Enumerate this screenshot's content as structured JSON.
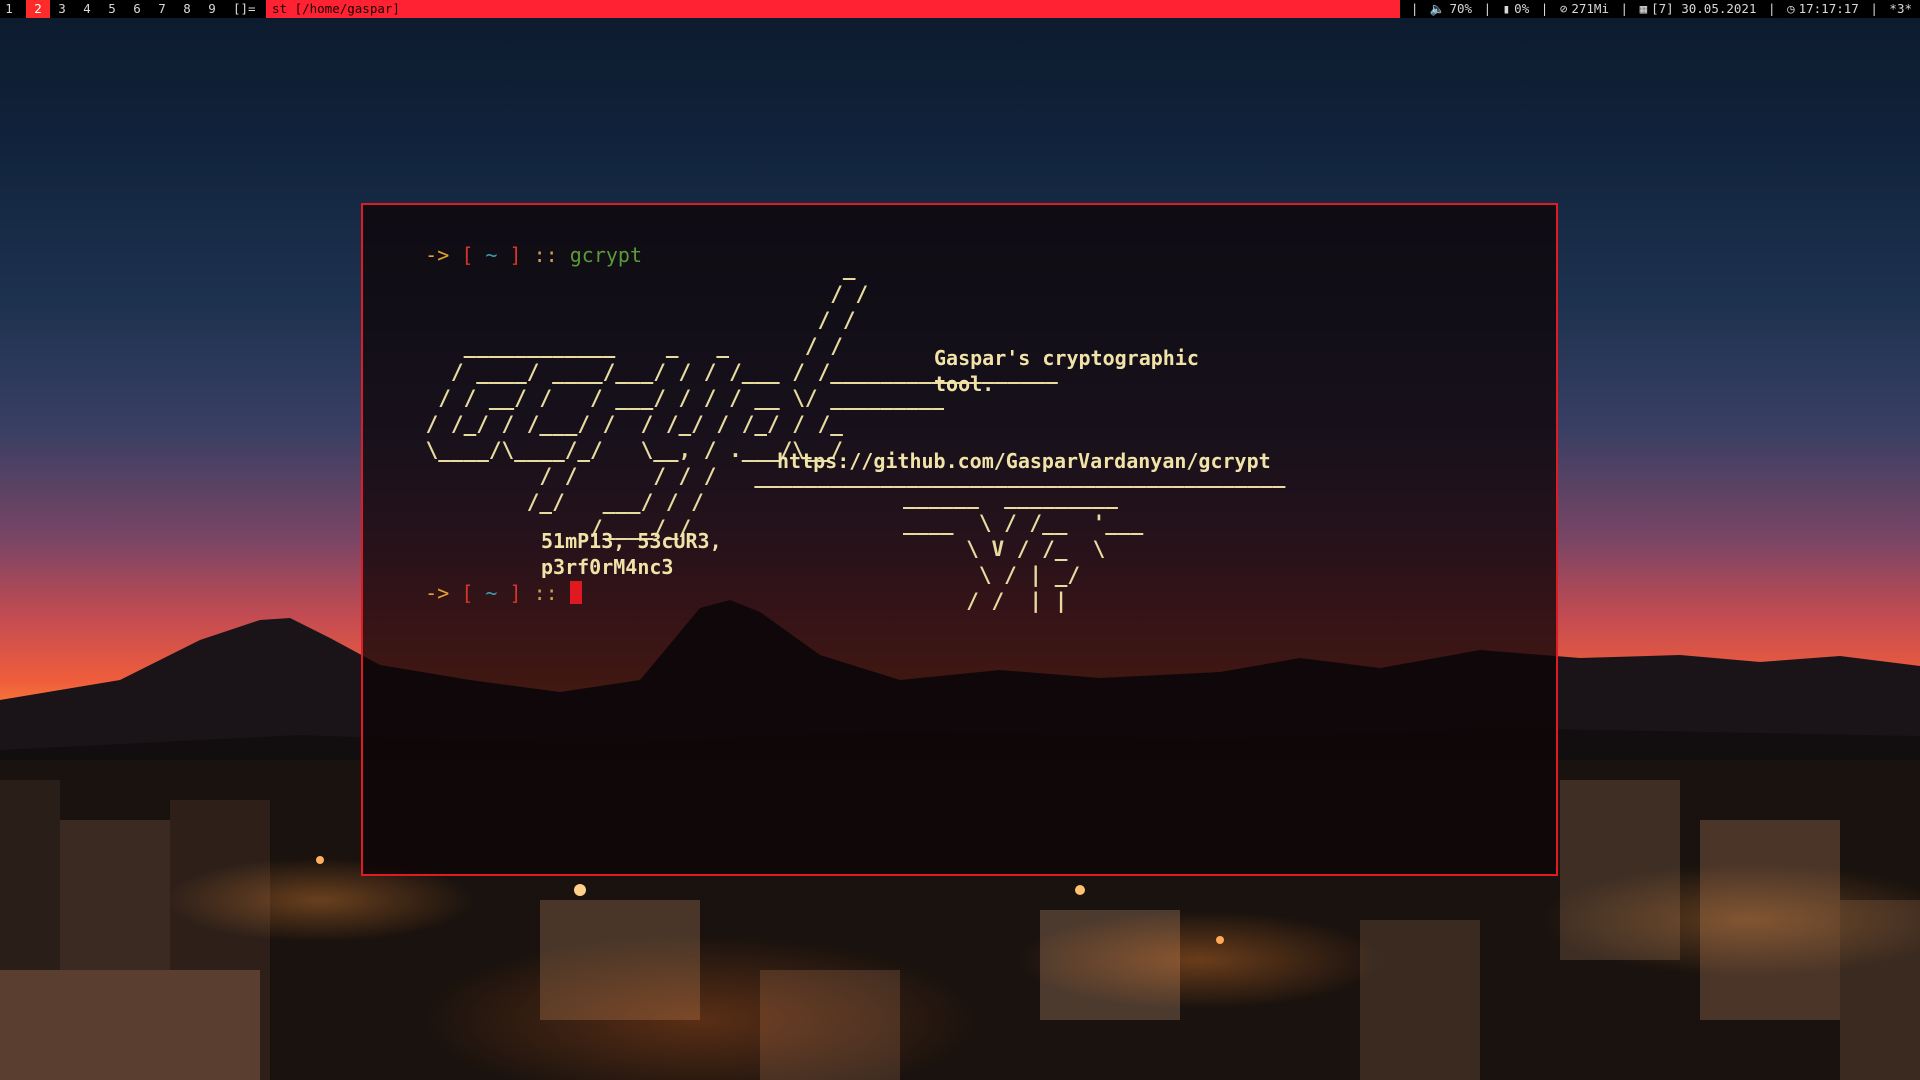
{
  "topbar": {
    "tags": [
      "1",
      "2",
      "3",
      "4",
      "5",
      "6",
      "7",
      "8",
      "9"
    ],
    "active_tag_index": 1,
    "layout_symbol": "[]=",
    "window_title": "st [/home/gaspar]",
    "status": {
      "volume": "70%",
      "battery": "0%",
      "memory": "271Mi",
      "date": "[7] 30.05.2021",
      "time": "17:17:17",
      "extra": "*3*"
    }
  },
  "terminal": {
    "prompt": {
      "arrow": "->",
      "open_bracket": "[",
      "cwd": "~",
      "close_bracket": "]",
      "separator": "::"
    },
    "command": "gcrypt",
    "tagline": "Gaspar's cryptographic\ntool.",
    "url": "https://github.com/GasparVardanyan/gcrypt",
    "motto": "51mP13, 53cUR3,\np3rf0rM4nc3"
  },
  "colors": {
    "accent": "#e01b24",
    "topbar_title_bg": "#ff2233",
    "text": "#e8dba0"
  }
}
